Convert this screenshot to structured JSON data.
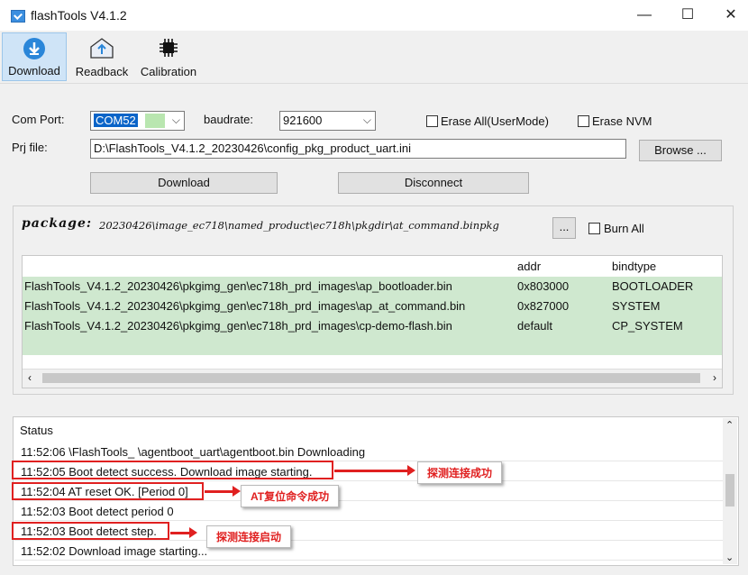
{
  "window": {
    "title": "flashTools V4.1.2",
    "minimize": "—",
    "maximize": "☐",
    "close": "✕"
  },
  "toolbar": {
    "download": "Download",
    "readback": "Readback",
    "calibration": "Calibration"
  },
  "form": {
    "com_port_label": "Com Port:",
    "com_port_value": "COM52",
    "baudrate_label": "baudrate:",
    "baudrate_value": "921600",
    "erase_all_label": "Erase All(UserMode)",
    "erase_nvm_label": "Erase NVM",
    "prj_file_label": "Prj file:",
    "prj_file_value": "D:\\FlashTools_V4.1.2_20230426\\config_pkg_product_uart.ini",
    "browse_label": "Browse ...",
    "download_label": "Download",
    "disconnect_label": "Disconnect"
  },
  "package": {
    "label": "package:",
    "path": "20230426\\image_ec718\\named_product\\ec718h\\pkgdir\\at_command.binpkg",
    "browse_label": "...",
    "burn_all_label": "Burn All",
    "columns": [
      "addr",
      "bindtype"
    ],
    "rows": [
      {
        "file": "FlashTools_V4.1.2_20230426\\pkgimg_gen\\ec718h_prd_images\\ap_bootloader.bin",
        "addr": "0x803000",
        "bindtype": "BOOTLOADER"
      },
      {
        "file": "FlashTools_V4.1.2_20230426\\pkgimg_gen\\ec718h_prd_images\\ap_at_command.bin",
        "addr": "0x827000",
        "bindtype": "SYSTEM"
      },
      {
        "file": "FlashTools_V4.1.2_20230426\\pkgimg_gen\\ec718h_prd_images\\cp-demo-flash.bin",
        "addr": "default",
        "bindtype": "CP_SYSTEM"
      }
    ]
  },
  "status": {
    "header": "Status",
    "lines": [
      "11:52:06  \\FlashTools_                              \\agentboot_uart\\agentboot.bin Downloading",
      "11:52:05 Boot detect success. Download image starting.",
      "11:52:04 AT reset  OK. [Period 0]",
      "11:52:03 Boot detect period 0",
      "11:52:03 Boot detect step.",
      "11:52:02 Download image starting..."
    ]
  },
  "annotations": {
    "note1": "探测连接成功",
    "note2": "AT复位命令成功",
    "note3": "探测连接启动"
  },
  "colors": {
    "accent": "#e02020",
    "selected_row": "#cfe8cf",
    "toolbar_active": "#cfe4f7"
  }
}
